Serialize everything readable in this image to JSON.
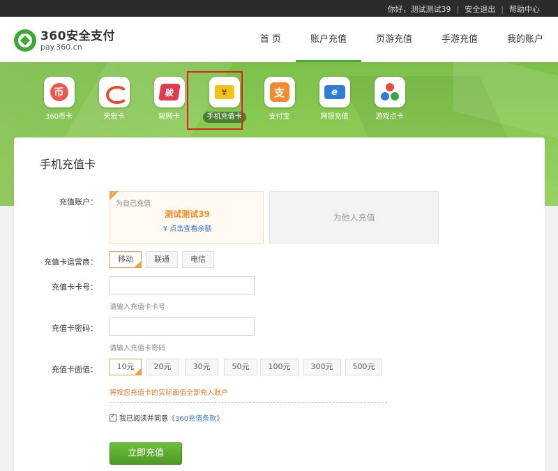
{
  "topbar": {
    "greeting": "你好，测试测试39",
    "logout": "安全退出",
    "help": "帮助中心"
  },
  "logo": {
    "title": "360安全支付",
    "url": "pay.360.cn"
  },
  "nav": {
    "items": [
      {
        "label": "首 页"
      },
      {
        "label": "账户充值",
        "active": true
      },
      {
        "label": "页游充值"
      },
      {
        "label": "手游充值"
      },
      {
        "label": "我的账户"
      }
    ]
  },
  "methods": {
    "items": [
      {
        "label": "360币卡",
        "icon": "coin-icon",
        "glyph": "币"
      },
      {
        "label": "天宏卡",
        "icon": "tianhong-icon"
      },
      {
        "label": "骏网卡",
        "icon": "junnet-icon",
        "glyph": "骏"
      },
      {
        "label": "手机充值卡",
        "icon": "mobile-card-icon",
        "glyph": "¥",
        "active": true
      },
      {
        "label": "支付宝",
        "icon": "alipay-icon",
        "glyph": "支"
      },
      {
        "label": "网银充值",
        "icon": "bank-icon",
        "glyph": "e"
      },
      {
        "label": "游戏点卡",
        "icon": "game-card-icon"
      }
    ]
  },
  "panel": {
    "title": "手机充值卡",
    "account": {
      "label": "充值账户：",
      "self_tag": "为自己充值",
      "self_name": "测试测试39",
      "balance_link": "¥ 点击查看余额",
      "other": "为他人充值"
    },
    "carrier": {
      "label": "充值卡运营商：",
      "options": [
        "移动",
        "联通",
        "电信"
      ],
      "selected": "移动"
    },
    "card_number": {
      "label": "充值卡卡号：",
      "hint": "请输入充值卡卡号",
      "value": ""
    },
    "card_password": {
      "label": "充值卡密码：",
      "hint": "请输入充值卡密码",
      "value": ""
    },
    "denomination": {
      "label": "充值卡面值：",
      "options": [
        "10元",
        "20元",
        "30元",
        "50元",
        "100元",
        "300元",
        "500元"
      ],
      "selected": "10元",
      "notice": "将按您充值卡的实际面值全部充入账户"
    },
    "agreement": {
      "text": "我已阅读并同意",
      "terms": "《360充值条款》",
      "checked": true
    },
    "submit": "立即充值"
  },
  "colors": {
    "brand_green": "#4da636",
    "accent_orange": "#f0a040",
    "link_blue": "#3a78c3",
    "highlight_red": "#e02020"
  }
}
